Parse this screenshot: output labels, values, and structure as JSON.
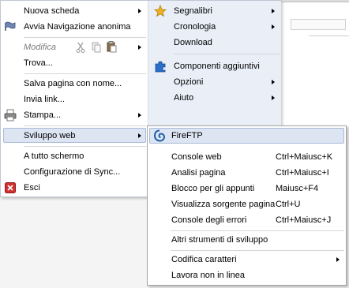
{
  "main_menu": {
    "left_items": [
      {
        "label": "Nuova scheda",
        "arrow": true
      },
      {
        "label": "Avvia Navigazione anonima",
        "arrow": false
      },
      {
        "label": "Modifica",
        "arrow": true
      },
      {
        "label": "Trova...",
        "arrow": false
      },
      {
        "label": "Salva pagina con nome...",
        "arrow": false
      },
      {
        "label": "Invia link...",
        "arrow": false
      },
      {
        "label": "Stampa...",
        "arrow": true
      },
      {
        "label": "Sviluppo web",
        "arrow": true
      },
      {
        "label": "A tutto schermo",
        "arrow": false
      },
      {
        "label": "Configurazione di Sync...",
        "arrow": false
      },
      {
        "label": "Esci",
        "arrow": false
      }
    ],
    "right_items": [
      {
        "label": "Segnalibri",
        "arrow": true
      },
      {
        "label": "Cronologia",
        "arrow": true
      },
      {
        "label": "Download",
        "arrow": false
      },
      {
        "label": "Componenti aggiuntivi",
        "arrow": false
      },
      {
        "label": "Opzioni",
        "arrow": true
      },
      {
        "label": "Aiuto",
        "arrow": true
      }
    ]
  },
  "submenu": {
    "items": [
      {
        "label": "FireFTP",
        "shortcut": ""
      },
      {
        "label": "Console web",
        "shortcut": "Ctrl+Maiusc+K"
      },
      {
        "label": "Analisi pagina",
        "shortcut": "Ctrl+Maiusc+I"
      },
      {
        "label": "Blocco per gli appunti",
        "shortcut": "Maiusc+F4"
      },
      {
        "label": "Visualizza sorgente pagina",
        "shortcut": "Ctrl+U"
      },
      {
        "label": "Console degli errori",
        "shortcut": "Ctrl+Maiusc+J"
      },
      {
        "label": "Altri strumenti di sviluppo",
        "shortcut": ""
      },
      {
        "label": "Codifica caratteri",
        "shortcut": ""
      },
      {
        "label": "Lavora non in linea",
        "shortcut": ""
      }
    ]
  },
  "colors": {
    "highlight_bg": "#dde5f2",
    "highlight_border": "#a6bad8",
    "right_column_bg": "#e9eef7",
    "exit_icon": "#d32f2f",
    "star_icon": "#f2b01e",
    "addon_icon": "#2a6fc9"
  }
}
